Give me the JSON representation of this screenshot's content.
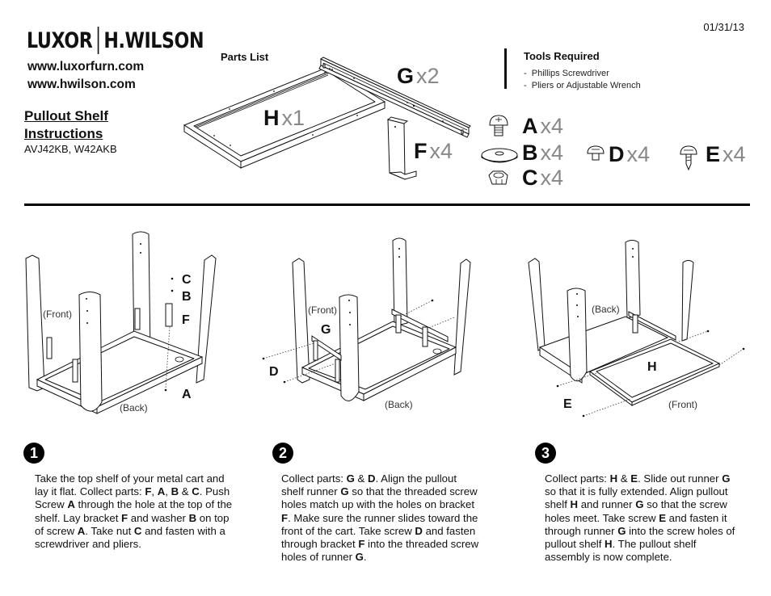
{
  "header": {
    "brand_left": "LUXOR",
    "brand_right": "H.WILSON",
    "urls": [
      "www.luxorfurn.com",
      "www.hwilson.com"
    ],
    "title_line1": "Pullout Shelf",
    "title_line2": "Instructions",
    "models": "AVJ42KB, W42AKB",
    "date": "01/31/13"
  },
  "parts_list": {
    "title": "Parts List",
    "parts": [
      {
        "letter": "H",
        "qty": "x1",
        "name": "pullout-shelf-frame"
      },
      {
        "letter": "G",
        "qty": "x2",
        "name": "runner"
      },
      {
        "letter": "F",
        "qty": "x4",
        "name": "bracket"
      },
      {
        "letter": "A",
        "qty": "x4",
        "name": "screw"
      },
      {
        "letter": "B",
        "qty": "x4",
        "name": "washer"
      },
      {
        "letter": "C",
        "qty": "x4",
        "name": "nut"
      },
      {
        "letter": "D",
        "qty": "x4",
        "name": "short-screw"
      },
      {
        "letter": "E",
        "qty": "x4",
        "name": "self-tapping-screw"
      }
    ]
  },
  "tools": {
    "title": "Tools Required",
    "items": [
      "Phillips Screwdriver",
      "Pliers or Adjustable Wrench"
    ]
  },
  "steps": [
    {
      "number": "1",
      "diagram_labels": {
        "front": "(Front)",
        "back": "(Back)",
        "parts": [
          "C",
          "B",
          "F",
          "A"
        ]
      },
      "segments": [
        {
          "t": "Take the top shelf of your metal cart and lay it flat. Collect parts: "
        },
        {
          "b": "F"
        },
        {
          "t": ", "
        },
        {
          "b": "A"
        },
        {
          "t": ", "
        },
        {
          "b": "B"
        },
        {
          "t": " & "
        },
        {
          "b": "C"
        },
        {
          "t": ". Push Screw "
        },
        {
          "b": "A"
        },
        {
          "t": " through the hole at the top of the shelf. Lay bracket "
        },
        {
          "b": "F"
        },
        {
          "t": " and washer "
        },
        {
          "b": "B"
        },
        {
          "t": " on top of screw "
        },
        {
          "b": "A"
        },
        {
          "t": ". Take nut "
        },
        {
          "b": "C"
        },
        {
          "t": " and fasten with a screwdriver and pliers."
        }
      ]
    },
    {
      "number": "2",
      "diagram_labels": {
        "front": "(Front)",
        "back": "(Back)",
        "parts": [
          "G",
          "D"
        ]
      },
      "segments": [
        {
          "t": "Collect parts: "
        },
        {
          "b": "G"
        },
        {
          "t": " & "
        },
        {
          "b": "D"
        },
        {
          "t": ". Align the pullout shelf runner "
        },
        {
          "b": "G"
        },
        {
          "t": " so that the threaded screw holes match up with the holes on bracket "
        },
        {
          "b": "F"
        },
        {
          "t": ". Make sure the runner slides toward the front of the cart. Take screw "
        },
        {
          "b": "D"
        },
        {
          "t": " and fasten through bracket "
        },
        {
          "b": "F"
        },
        {
          "t": " into the threaded screw holes of runner "
        },
        {
          "b": "G"
        },
        {
          "t": "."
        }
      ]
    },
    {
      "number": "3",
      "diagram_labels": {
        "front": "(Front)",
        "back": "(Back)",
        "parts": [
          "H",
          "E"
        ]
      },
      "segments": [
        {
          "t": "Collect parts: "
        },
        {
          "b": "H"
        },
        {
          "t": " & "
        },
        {
          "b": "E"
        },
        {
          "t": ". Slide out runner "
        },
        {
          "b": "G"
        },
        {
          "t": " so that it is fully extended. Align pullout shelf "
        },
        {
          "b": "H"
        },
        {
          "t": " and runner "
        },
        {
          "b": "G"
        },
        {
          "t": " so that the screw holes meet. Take screw "
        },
        {
          "b": "E"
        },
        {
          "t": " and fasten it through runner "
        },
        {
          "b": "G"
        },
        {
          "t": " into the screw holes of pullout shelf "
        },
        {
          "b": "H"
        },
        {
          "t": ". The pullout shelf assembly is now complete."
        }
      ]
    }
  ]
}
